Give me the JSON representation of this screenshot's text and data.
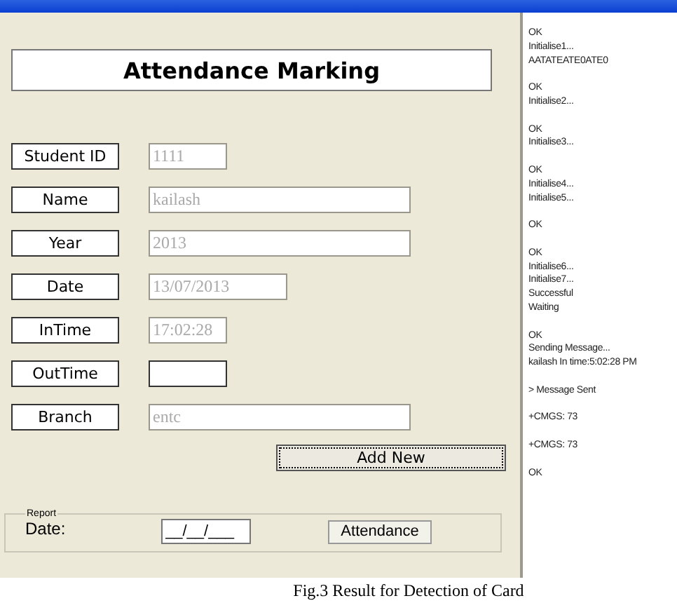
{
  "heading": "Attendance Marking",
  "fields": [
    {
      "label": "Student ID",
      "value": "1111",
      "kind": "short",
      "disabled": true
    },
    {
      "label": "Name",
      "value": "kailash",
      "kind": "long",
      "disabled": true
    },
    {
      "label": "Year",
      "value": "2013",
      "kind": "long",
      "disabled": true
    },
    {
      "label": "Date",
      "value": "13/07/2013",
      "kind": "medium",
      "disabled": true
    },
    {
      "label": "InTime",
      "value": "17:02:28",
      "kind": "short",
      "disabled": true
    },
    {
      "label": "OutTime",
      "kind": "short",
      "disabled": false
    },
    {
      "label": "Branch",
      "value": "entc",
      "kind": "long",
      "disabled": true
    }
  ],
  "add_button": {
    "label": "Add New",
    "focused": true
  },
  "report": {
    "legend": "Report",
    "date_label": "Date:",
    "date_value": "__/__/___",
    "button": "Attendance"
  },
  "log": [
    [
      "OK",
      "Initialise1...",
      "AATATEATE0ATE0"
    ],
    [
      "OK",
      "Initialise2..."
    ],
    [
      "OK",
      "Initialise3..."
    ],
    [
      "OK",
      "Initialise4...",
      "Initialise5..."
    ],
    [
      "OK"
    ],
    [
      "OK",
      "Initialise6...",
      "Initialise7...",
      "Successful",
      "Waiting"
    ],
    [
      "OK",
      "Sending Message...",
      "kailash In time:5:02:28 PM"
    ],
    [
      "> Message Sent"
    ],
    [
      "+CMGS: 73"
    ],
    [
      "+CMGS: 73"
    ],
    [
      "OK"
    ]
  ],
  "caption": "Fig.3 Result for Detection of Card"
}
